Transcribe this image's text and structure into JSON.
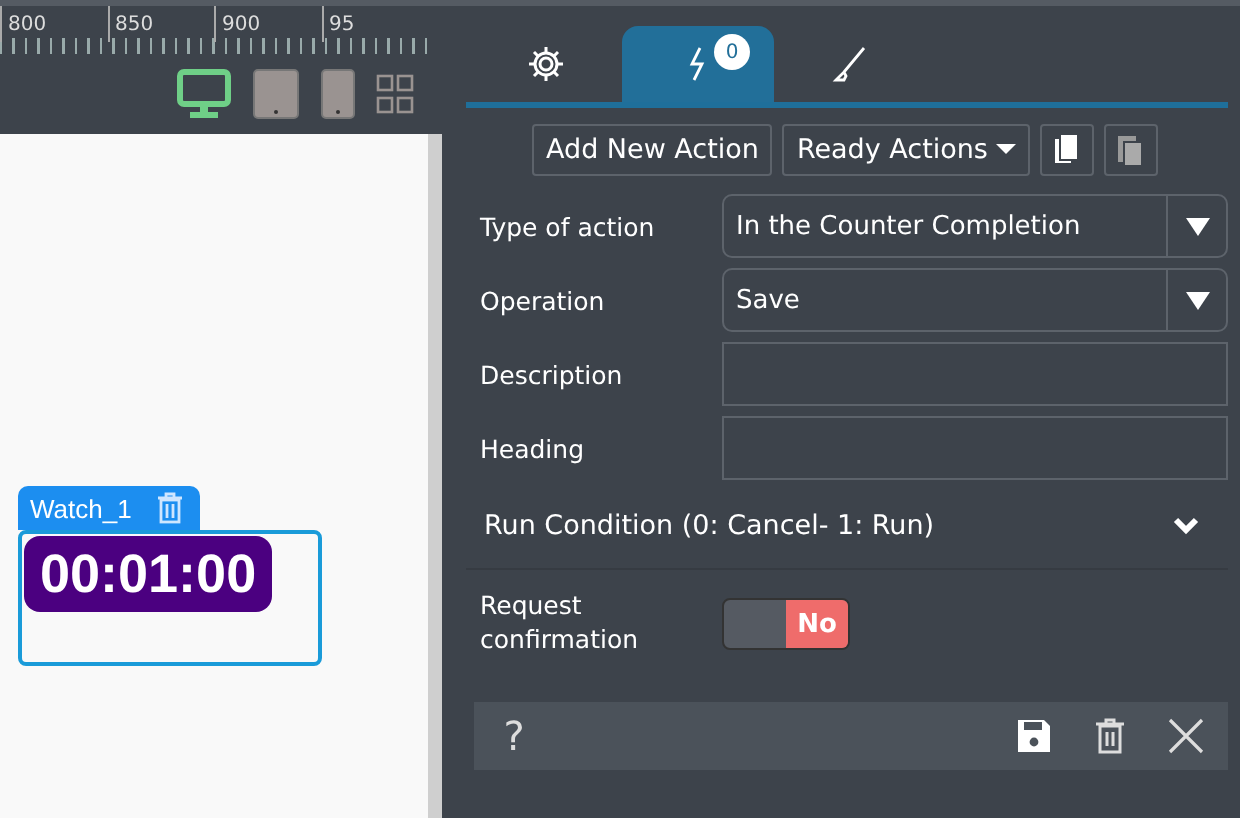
{
  "ruler": {
    "labels": [
      "800",
      "850",
      "900",
      "95"
    ]
  },
  "devices": [
    {
      "kind": "desktop",
      "selected": true
    },
    {
      "kind": "tablet",
      "selected": false
    },
    {
      "kind": "phone",
      "selected": false
    },
    {
      "kind": "grid",
      "selected": false
    }
  ],
  "widget": {
    "name": "Watch_1",
    "time": "00:01:00"
  },
  "tabs": [
    {
      "kind": "settings",
      "selected": false
    },
    {
      "kind": "actions",
      "selected": true,
      "badge": "0"
    },
    {
      "kind": "style",
      "selected": false
    }
  ],
  "toolbar": {
    "add": "Add New Action",
    "ready": "Ready Actions"
  },
  "form": [
    {
      "label": "Type of action",
      "kind": "select",
      "value": "In the Counter Completion"
    },
    {
      "label": "Operation",
      "kind": "select",
      "value": "Save"
    },
    {
      "label": "Description",
      "kind": "text"
    },
    {
      "label": "Heading",
      "kind": "text"
    }
  ],
  "run_condition": {
    "label": "Run Condition (0: Cancel- 1: Run)",
    "expanded": false
  },
  "confirmation": {
    "label": "Request confirmation",
    "on": false,
    "state_text": "No"
  },
  "footer": {
    "help": "?"
  }
}
